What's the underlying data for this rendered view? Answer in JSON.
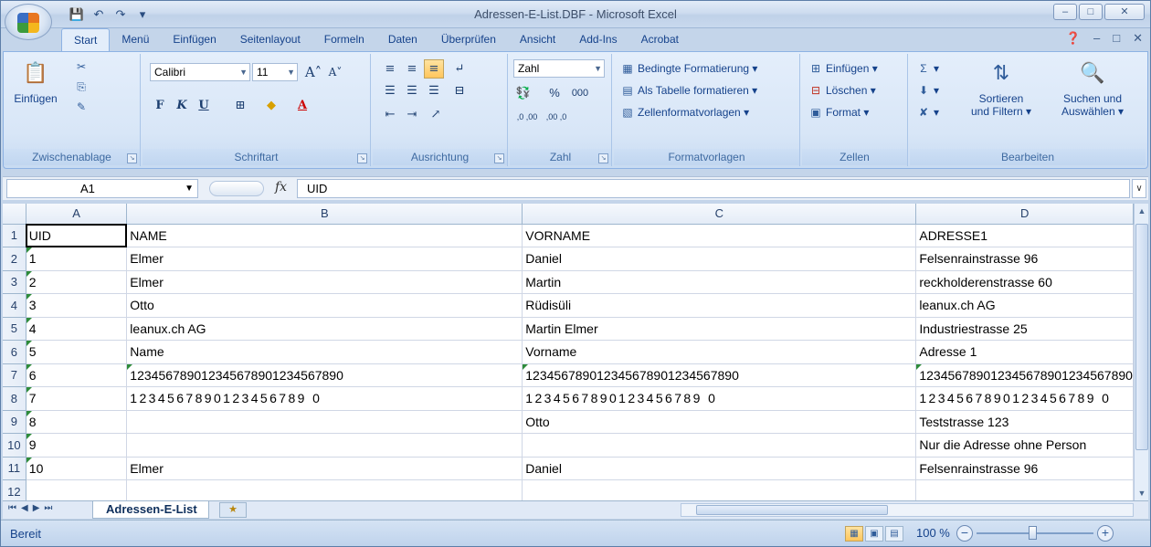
{
  "window": {
    "title": "Adressen-E-List.DBF - Microsoft Excel"
  },
  "ribbon_tabs": [
    "Start",
    "Menü",
    "Einfügen",
    "Seitenlayout",
    "Formeln",
    "Daten",
    "Überprüfen",
    "Ansicht",
    "Add-Ins",
    "Acrobat"
  ],
  "groups": {
    "clipboard": {
      "label": "Zwischenablage",
      "paste": "Einfügen"
    },
    "font": {
      "label": "Schriftart",
      "font_name": "Calibri",
      "font_size": "11",
      "bold": "F",
      "italic": "K",
      "underline": "U"
    },
    "alignment": {
      "label": "Ausrichtung"
    },
    "number": {
      "label": "Zahl",
      "format": "Zahl",
      "percent": "%",
      "thousands": "000",
      "inc_dec": ",0 ,00",
      "dec_dec": ",00 ,0"
    },
    "styles": {
      "label": "Formatvorlagen",
      "conditional": "Bedingte Formatierung",
      "as_table": "Als Tabelle formatieren",
      "cell_styles": "Zellenformatvorlagen"
    },
    "cells": {
      "label": "Zellen",
      "insert": "Einfügen",
      "delete": "Löschen",
      "format": "Format"
    },
    "editing": {
      "label": "Bearbeiten",
      "sort_line1": "Sortieren",
      "sort_line2": "und Filtern",
      "find_line1": "Suchen und",
      "find_line2": "Auswählen"
    }
  },
  "formula_bar": {
    "name_box": "A1",
    "fx": "fx",
    "formula": "UID"
  },
  "columns": [
    "A",
    "B",
    "C",
    "D"
  ],
  "rows": [
    {
      "n": "1",
      "a": "UID",
      "b": "NAME",
      "c": "VORNAME",
      "d": "ADRESSE1"
    },
    {
      "n": "2",
      "a": "1",
      "b": "Elmer",
      "c": "Daniel",
      "d": "Felsenrainstrasse 96"
    },
    {
      "n": "3",
      "a": "2",
      "b": "Elmer",
      "c": "Martin",
      "d": "reckholderenstrasse 60"
    },
    {
      "n": "4",
      "a": "3",
      "b": "Otto",
      "c": "Rüdisüli",
      "d": "leanux.ch AG"
    },
    {
      "n": "5",
      "a": "4",
      "b": "leanux.ch AG",
      "c": "Martin Elmer",
      "d": "Industriestrasse 25"
    },
    {
      "n": "6",
      "a": "5",
      "b": "Name",
      "c": "Vorname",
      "d": "Adresse 1"
    },
    {
      "n": "7",
      "a": "6",
      "b": "123456789012345678901234567890",
      "c": "123456789012345678901234567890",
      "d": "123456789012345678901234567890"
    },
    {
      "n": "8",
      "a": "7",
      "b": "1234567890123456789 0",
      "c": "1234567890123456789 0",
      "d": "1234567890123456789 0"
    },
    {
      "n": "9",
      "a": "8",
      "b": "",
      "c": "Otto",
      "d": "Teststrasse 123"
    },
    {
      "n": "10",
      "a": "9",
      "b": "",
      "c": "",
      "d": "Nur die Adresse ohne Person"
    },
    {
      "n": "11",
      "a": "10",
      "b": "Elmer",
      "c": "Daniel",
      "d": "Felsenrainstrasse 96"
    },
    {
      "n": "12",
      "a": "",
      "b": "",
      "c": "",
      "d": ""
    }
  ],
  "sheet_tab": "Adressen-E-List",
  "status": {
    "text": "Bereit",
    "zoom": "100 %"
  }
}
